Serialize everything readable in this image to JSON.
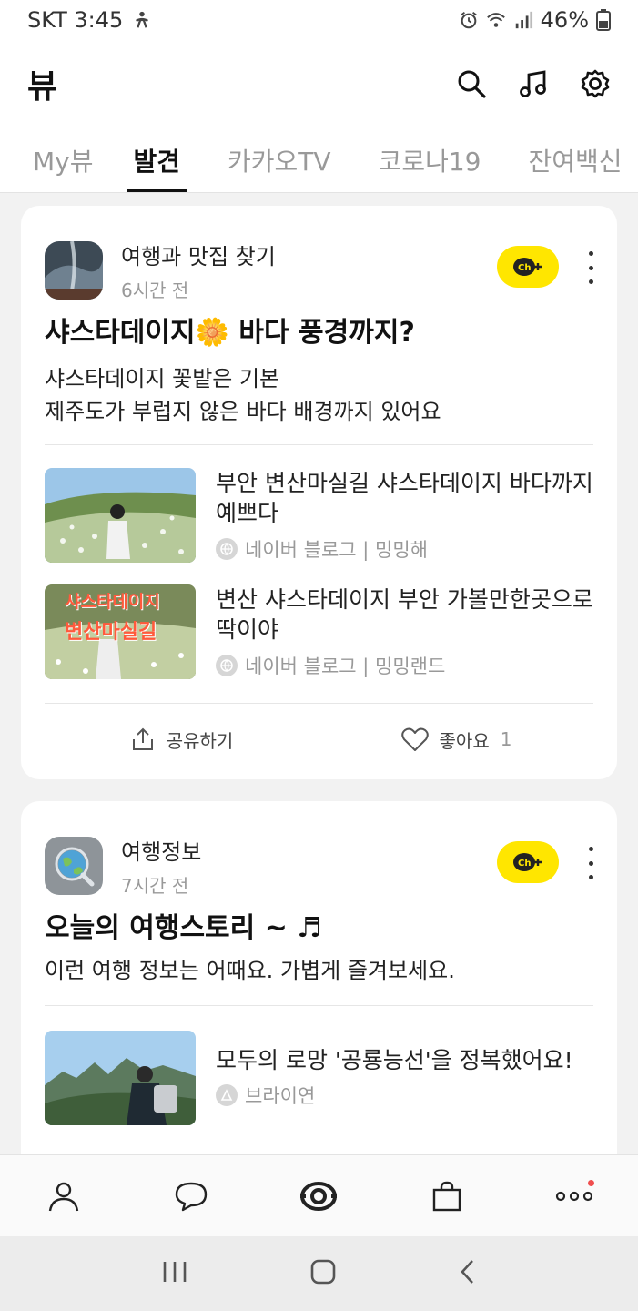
{
  "status_bar": {
    "carrier_time": "SKT 3:45",
    "battery": "46%"
  },
  "header": {
    "title": "뷰"
  },
  "tabs": [
    {
      "label": "My뷰",
      "active": false
    },
    {
      "label": "발견",
      "active": true
    },
    {
      "label": "카카오TV",
      "active": false
    },
    {
      "label": "코로나19",
      "active": false
    },
    {
      "label": "잔여백신",
      "active": false
    }
  ],
  "cards": [
    {
      "channel_name": "여행과 맛집 찾기",
      "time": "6시간 전",
      "title": "샤스타데이지🌼 바다 풍경까지?",
      "desc_line1": "샤스타데이지 꽃밭은 기본",
      "desc_line2": "제주도가 부럽지 않은 바다 배경까지 있어요",
      "items": [
        {
          "title": "부안 변산마실길 샤스타데이지 바다까지 예쁘다",
          "source": "네이버 블로그 | 밍밍해"
        },
        {
          "title": "변산 샤스타데이지 부안 가볼만한곳으로 딱이야",
          "source": "네이버 블로그 | 밍밍랜드",
          "image_text_1": "샤스타데이지",
          "image_text_2": "변산마실길"
        }
      ],
      "share_label": "공유하기",
      "like_label": "좋아요",
      "like_count": "1"
    },
    {
      "channel_name": "여행정보",
      "time": "7시간 전",
      "title": "오늘의 여행스토리 ~ ♬",
      "desc_line1": "이런 여행 정보는 어때요. 가볍게 즐겨보세요.",
      "items": [
        {
          "title": "모두의 로망 '공룡능선'을 정복했어요!",
          "source": "브라이연"
        }
      ]
    }
  ],
  "colors": {
    "accent_yellow": "#ffe600",
    "notification_dot": "#f04e4e"
  }
}
